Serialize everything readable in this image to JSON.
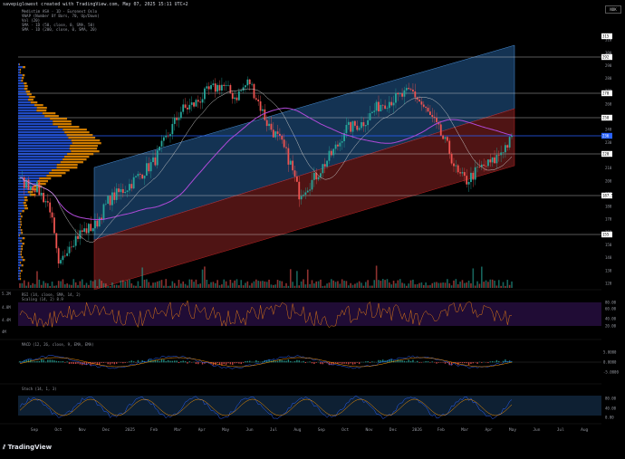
{
  "header": {
    "attribution": "savepiglowest created with TradingView.com, May 07, 2025 15:11 UTC+2",
    "currency_badge": "NOK"
  },
  "legend": {
    "symbol_line": "Medistim ASA · 1D · Euronext Oslo",
    "vwap_line": "VWAP (Number Of Bars, 70, Up/Down)",
    "vol_line": "Vol (20)",
    "sma50_line": "SMA · 1D (50, close, 0, SMA, 50)",
    "sma200_line": "SMA · 1D (200, close, 0, SMA, 20)"
  },
  "price_axis": {
    "ticks": [
      "310",
      "300",
      "290",
      "280",
      "270",
      "260",
      "250",
      "240",
      "230",
      "220",
      "210",
      "200",
      "190",
      "180",
      "170",
      "160",
      "150",
      "140",
      "130",
      "120"
    ],
    "labels": [
      {
        "text": "315",
        "color": "#ffffff",
        "bg": "#ffffff"
      },
      {
        "text": "292",
        "color": "#ffffff",
        "bg": "#ffffff"
      },
      {
        "text": "270",
        "color": "#ffffff",
        "bg": "#ffffff"
      },
      {
        "text": "250",
        "color": "#ffffff",
        "bg": "#ffffff"
      },
      {
        "text": "236",
        "color": "#ffffff",
        "bg": "#2962ff"
      },
      {
        "text": "220",
        "color": "#ffffff",
        "bg": "#ffffff"
      },
      {
        "text": "187.5",
        "color": "#ffffff",
        "bg": "#ffffff"
      },
      {
        "text": "155",
        "color": "#ffffff",
        "bg": "#ffffff"
      }
    ]
  },
  "rsi_panel": {
    "label": "RSI (14, close, SMA, 14, 2)",
    "sub_label": "Scaling (14, 2) 8.9",
    "ticks": [
      "80.00",
      "60.00",
      "40.00",
      "20.00"
    ],
    "left_ticks": [
      "5.2M",
      "4.8M",
      "4.4M",
      "4M"
    ]
  },
  "macd_panel": {
    "label": "MACD (12, 26, close, 9, EMA, EMA)",
    "ticks": [
      "5.0000",
      "0.0000",
      "-5.0000"
    ]
  },
  "stoch_panel": {
    "label": "Stoch (14, 1, 3)",
    "ticks": [
      "80.00",
      "40.00",
      "0.00"
    ]
  },
  "time_axis": [
    "Sep",
    "Oct",
    "Nov",
    "Dec",
    "2025",
    "Feb",
    "Mar",
    "Apr",
    "May",
    "Jun",
    "Jul",
    "Aug",
    "Sep",
    "Oct",
    "Nov",
    "Dec",
    "2026",
    "Feb",
    "Mar",
    "Apr",
    "May",
    "Jun",
    "Jul",
    "Aug"
  ],
  "brand": "TradingView",
  "colors": {
    "upper_channel": "#2962ff",
    "lower_channel": "#e53935",
    "sma50": "#b2b5be",
    "sma200": "#9c27b0",
    "up_candle": "#26a69a",
    "down_candle": "#ef5350",
    "volume_profile_up": "#2962ff",
    "volume_profile_down": "#ff9800"
  }
}
